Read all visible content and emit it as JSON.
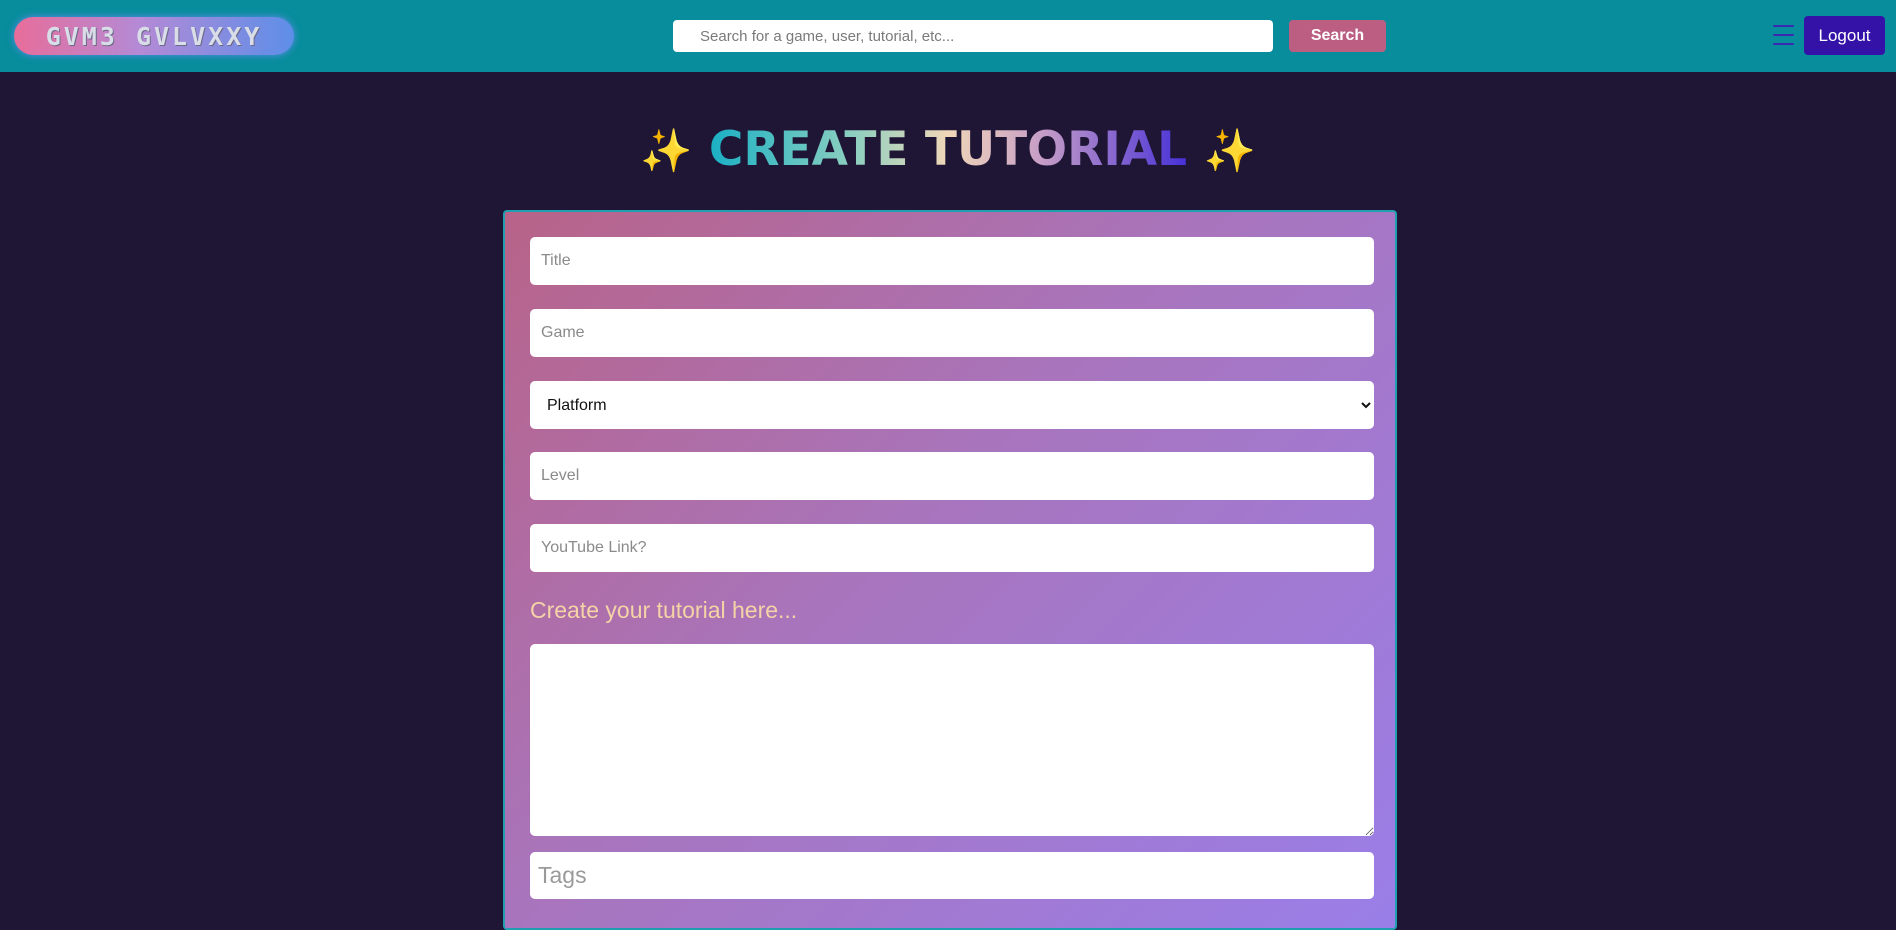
{
  "navbar": {
    "logo_text": "GVM3 GVLVXXY",
    "search_placeholder": "Search for a game, user, tutorial, etc...",
    "search_button": "Search",
    "menu_icon": "hamburger-menu-icon",
    "logout_button": "Logout"
  },
  "page": {
    "title": "CREATE TUTORIAL",
    "sparkle_left": "✨",
    "sparkle_right": "✨"
  },
  "form": {
    "title_placeholder": "Title",
    "game_placeholder": "Game",
    "platform_selected": "Platform",
    "level_placeholder": "Level",
    "youtube_placeholder": "YouTube Link?",
    "editor_label": "Create your tutorial here...",
    "editor_value": "",
    "tags_placeholder": "Tags"
  },
  "colors": {
    "navbar_bg": "#078d9c",
    "page_bg": "#1f1535",
    "search_button_bg": "#bb5e82",
    "logout_button_bg": "#3412a8",
    "editor_label_color": "#f4d4a6"
  }
}
